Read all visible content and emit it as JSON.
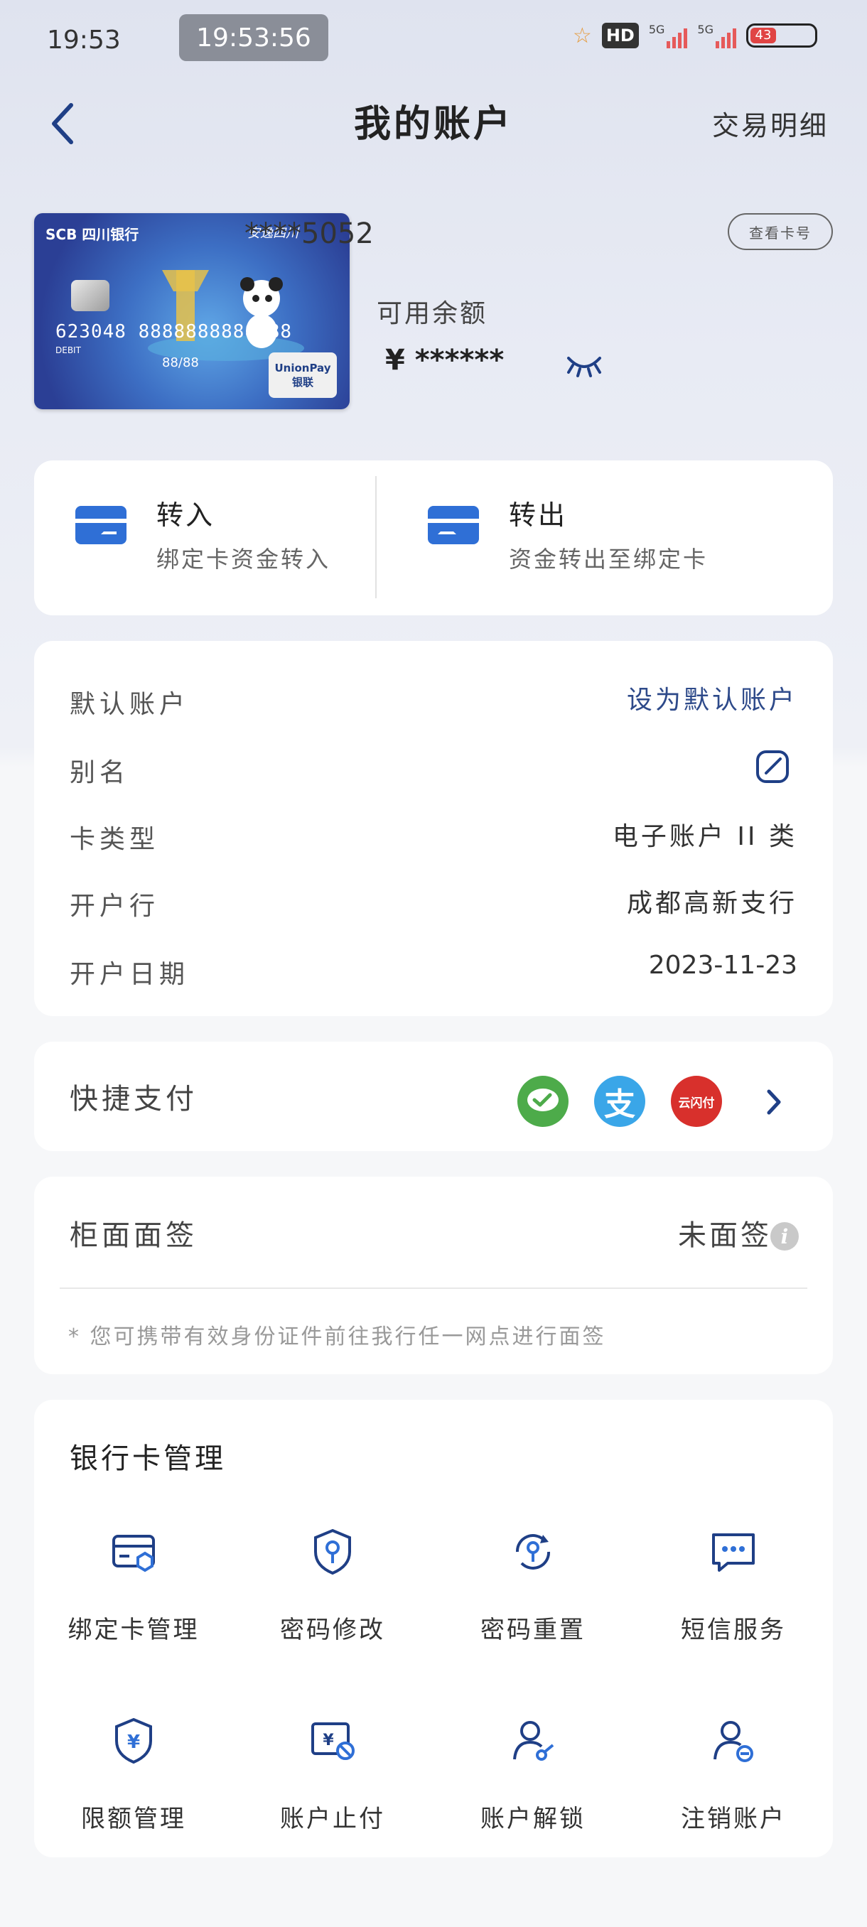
{
  "status": {
    "time": "19:53",
    "clock": "19:53:56",
    "battery": "43",
    "signal1": "5G",
    "signal2": "5G",
    "hd": "HD"
  },
  "header": {
    "title": "我的账户",
    "right_link": "交易明细"
  },
  "card": {
    "number_masked": "****5052",
    "view_button": "查看卡号",
    "balance_label": "可用余额",
    "balance_value": "¥ ******",
    "card_face": {
      "bank": "SCB 四川银行",
      "number": "623048 8888888888888",
      "debit": "DEBIT",
      "valid": "88/88",
      "brand": "UnionPay 银联",
      "slogan": "安逸四川"
    }
  },
  "transfer": {
    "in": {
      "title": "转入",
      "subtitle": "绑定卡资金转入"
    },
    "out": {
      "title": "转出",
      "subtitle": "资金转出至绑定卡"
    }
  },
  "info": {
    "default_account": {
      "label": "默认账户",
      "value": "设为默认账户"
    },
    "alias": {
      "label": "别名"
    },
    "card_type": {
      "label": "卡类型",
      "value": "电子账户 II 类"
    },
    "branch": {
      "label": "开户行",
      "value": "成都高新支行"
    },
    "open_date": {
      "label": "开户日期",
      "value": "2023-11-23"
    }
  },
  "quick_pay": {
    "label": "快捷支付",
    "unionpay_text": "云闪付"
  },
  "sign": {
    "label": "柜面面签",
    "status": "未面签",
    "note": "* 您可携带有效身份证件前往我行任一网点进行面签"
  },
  "manage": {
    "title": "银行卡管理",
    "items": [
      {
        "label": "绑定卡管理",
        "icon": "card-bind-icon"
      },
      {
        "label": "密码修改",
        "icon": "password-change-icon"
      },
      {
        "label": "密码重置",
        "icon": "password-reset-icon"
      },
      {
        "label": "短信服务",
        "icon": "sms-icon"
      },
      {
        "label": "限额管理",
        "icon": "limit-shield-icon"
      },
      {
        "label": "账户止付",
        "icon": "stop-payment-icon"
      },
      {
        "label": "账户解锁",
        "icon": "account-unlock-icon"
      },
      {
        "label": "注销账户",
        "icon": "close-account-icon"
      }
    ]
  },
  "colors": {
    "accent": "#2e4a8a",
    "icon_blue": "#1f3f86",
    "transfer_blue": "#2f6fd6"
  }
}
